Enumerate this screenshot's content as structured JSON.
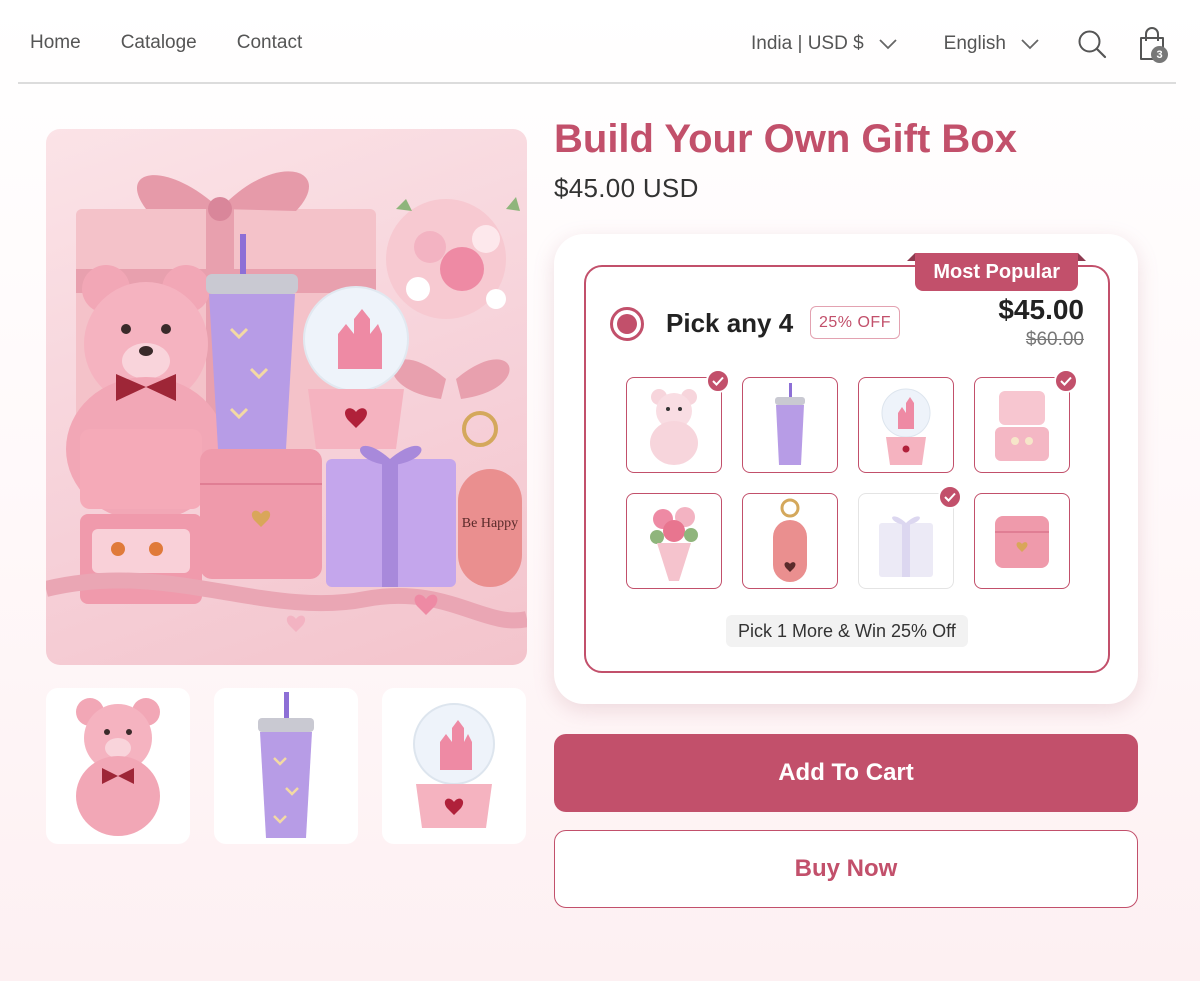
{
  "nav": {
    "links": [
      "Home",
      "Cataloge",
      "Contact"
    ],
    "region": "India | USD $",
    "language": "English",
    "cart_count": "3"
  },
  "product": {
    "title": "Build Your Own Gift Box",
    "price": "$45.00 USD"
  },
  "bundle": {
    "badge": "Most Popular",
    "label": "Pick any 4",
    "discount": "25% OFF",
    "price": "$45.00",
    "compare_price": "$60.00",
    "items": [
      {
        "icon": "teddy-bear-icon",
        "selected": true
      },
      {
        "icon": "tumbler-icon",
        "selected": false
      },
      {
        "icon": "snow-globe-icon",
        "selected": false
      },
      {
        "icon": "jewelry-box-icon",
        "selected": true
      },
      {
        "icon": "flower-bouquet-icon",
        "selected": false
      },
      {
        "icon": "keychain-icon",
        "selected": false
      },
      {
        "icon": "gift-box-icon",
        "selected": true
      },
      {
        "icon": "wallet-icon",
        "selected": false
      }
    ],
    "hint": "Pick 1 More & Win 25% Off"
  },
  "keychain_text": "Be Happy",
  "actions": {
    "add_to_cart": "Add To Cart",
    "buy_now": "Buy Now"
  },
  "colors": {
    "accent": "#c2506b",
    "lavender": "#b79ce6",
    "pink": "#f2a7b6"
  }
}
